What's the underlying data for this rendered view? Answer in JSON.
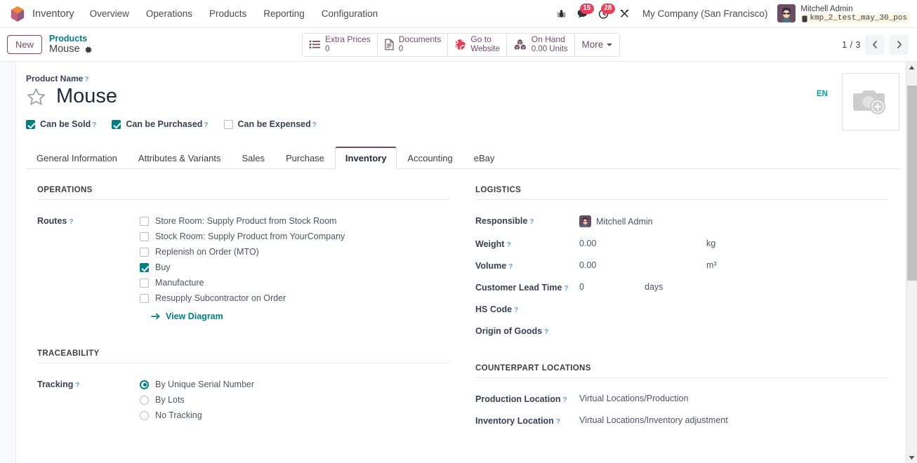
{
  "navbar": {
    "logo_icon": "odoo-logo-icon",
    "app_name": "Inventory",
    "menu": [
      {
        "label": "Overview"
      },
      {
        "label": "Operations"
      },
      {
        "label": "Products"
      },
      {
        "label": "Reporting"
      },
      {
        "label": "Configuration"
      }
    ],
    "sys_icons": [
      {
        "name": "bug-icon",
        "badge": ""
      },
      {
        "name": "messaging-icon",
        "badge": "15"
      },
      {
        "name": "activities-clock-icon",
        "badge": "28"
      },
      {
        "name": "tools-icon",
        "badge": ""
      }
    ],
    "company": "My Company (San Francisco)",
    "user": {
      "name": "Mitchell Admin",
      "database": "kmp_2_test_may_30_pos",
      "db_icon": "database-icon",
      "avatar_icon": "user-avatar"
    }
  },
  "control_panel": {
    "new_label": "New",
    "breadcrumb_parent": "Products",
    "breadcrumb_current": "Mouse",
    "gear_icon": "gear-icon",
    "stat_buttons": [
      {
        "icon": "list-icon",
        "label": "Extra Prices",
        "value": "0"
      },
      {
        "icon": "document-icon",
        "label": "Documents",
        "value": "0"
      },
      {
        "icon": "globe-icon",
        "label": "Go to",
        "value": "Website"
      },
      {
        "icon": "boxes-icon",
        "label": "On Hand",
        "value": "0.00 Units"
      }
    ],
    "more_label": "More",
    "pager": {
      "text": "1 / 3",
      "prev_icon": "chevron-left-icon",
      "next_icon": "chevron-right-icon"
    }
  },
  "form": {
    "product_name_label": "Product Name",
    "product_name": "Mouse",
    "star_icon": "star-favorite-icon",
    "language_badge": "EN",
    "image_placeholder_icon": "camera-add-icon",
    "checkboxes": [
      {
        "label": "Can be Sold",
        "checked": true
      },
      {
        "label": "Can be Purchased",
        "checked": true
      },
      {
        "label": "Can be Expensed",
        "checked": false
      }
    ],
    "tabs": [
      {
        "label": "General Information",
        "active": false
      },
      {
        "label": "Attributes & Variants",
        "active": false
      },
      {
        "label": "Sales",
        "active": false
      },
      {
        "label": "Purchase",
        "active": false
      },
      {
        "label": "Inventory",
        "active": true
      },
      {
        "label": "Accounting",
        "active": false
      },
      {
        "label": "eBay",
        "active": false
      }
    ],
    "operations": {
      "title": "OPERATIONS",
      "routes_label": "Routes",
      "routes": [
        {
          "label": "Store Room: Supply Product from Stock Room",
          "checked": false
        },
        {
          "label": "Stock Room: Supply Product from YourCompany",
          "checked": false
        },
        {
          "label": "Replenish on Order (MTO)",
          "checked": false
        },
        {
          "label": "Buy",
          "checked": true
        },
        {
          "label": "Manufacture",
          "checked": false
        },
        {
          "label": "Resupply Subcontractor on Order",
          "checked": false
        }
      ],
      "view_diagram_label": "View Diagram",
      "view_diagram_icon": "arrow-right-icon"
    },
    "logistics": {
      "title": "LOGISTICS",
      "responsible_label": "Responsible",
      "responsible_value": "Mitchell Admin",
      "weight_label": "Weight",
      "weight_value": "0.00",
      "weight_unit": "kg",
      "volume_label": "Volume",
      "volume_value": "0.00",
      "volume_unit": "m³",
      "lead_time_label": "Customer Lead Time",
      "lead_time_value": "0",
      "lead_time_unit": "days",
      "hs_code_label": "HS Code",
      "hs_code_value": "",
      "origin_label": "Origin of Goods",
      "origin_value": ""
    },
    "traceability": {
      "title": "TRACEABILITY",
      "tracking_label": "Tracking",
      "options": [
        {
          "label": "By Unique Serial Number",
          "selected": true
        },
        {
          "label": "By Lots",
          "selected": false
        },
        {
          "label": "No Tracking",
          "selected": false
        }
      ]
    },
    "counterpart": {
      "title": "COUNTERPART LOCATIONS",
      "production_label": "Production Location",
      "production_value": "Virtual Locations/Production",
      "inventory_label": "Inventory Location",
      "inventory_value": "Virtual Locations/Inventory adjustment"
    }
  },
  "colors": {
    "brand_primary": "#714b67",
    "accent_teal": "#017e84",
    "badge_red": "#e6425e",
    "link_blue": "#5ba4cf"
  }
}
